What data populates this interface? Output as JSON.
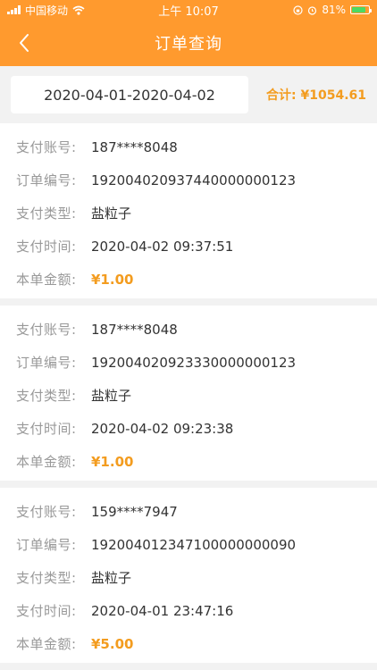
{
  "status_bar": {
    "carrier": "中国移动",
    "time": "上午 10:07",
    "battery": "81%"
  },
  "header": {
    "title": "订单查询"
  },
  "filter": {
    "date_range": "2020-04-01-2020-04-02",
    "total": "合计: ¥1054.61"
  },
  "labels": {
    "account": "支付账号:",
    "order_no": "订单编号:",
    "pay_type": "支付类型:",
    "pay_time": "支付时间:",
    "amount": "本单金额:"
  },
  "orders": [
    {
      "account": "187****8048",
      "order_no": "192004020937440000000123",
      "pay_type": "盐粒子",
      "pay_time": "2020-04-02 09:37:51",
      "amount": "¥1.00"
    },
    {
      "account": "187****8048",
      "order_no": "192004020923330000000123",
      "pay_type": "盐粒子",
      "pay_time": "2020-04-02 09:23:38",
      "amount": "¥1.00"
    },
    {
      "account": "159****7947",
      "order_no": "192004012347100000000090",
      "pay_type": "盐粒子",
      "pay_time": "2020-04-01 23:47:16",
      "amount": "¥5.00"
    }
  ],
  "colors": {
    "brand": "#ff9a2e",
    "accent_amount": "#f39c1f",
    "battery_fill": "#4cd964"
  }
}
